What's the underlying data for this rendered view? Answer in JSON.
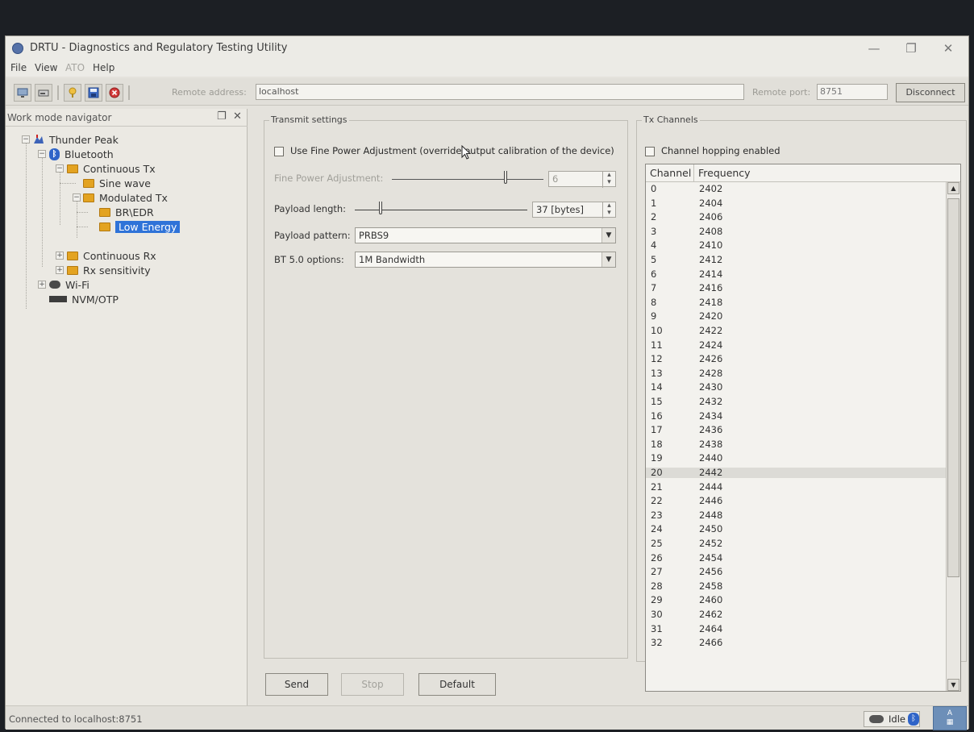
{
  "window": {
    "title": "DRTU - Diagnostics and Regulatory Testing Utility",
    "controls": {
      "minimize": "—",
      "restore": "❐",
      "close": "✕"
    }
  },
  "menu": [
    "File",
    "View",
    "ATO",
    "Help"
  ],
  "toolbar": {
    "remote_address_label": "Remote address:",
    "remote_address_value": "localhost",
    "remote_port_label": "Remote port:",
    "remote_port_value": "8751",
    "disconnect_label": "Disconnect",
    "icons": [
      "monitor-icon",
      "drive-icon",
      "pin-icon",
      "save-icon",
      "stop-icon"
    ]
  },
  "navigator": {
    "title": "Work mode navigator",
    "pin_glyph": "❐",
    "close_glyph": "✕",
    "items": [
      {
        "label": "Thunder Peak",
        "icon": "thunder-peak-icon",
        "expanded": true
      },
      {
        "label": "Bluetooth",
        "icon": "bluetooth-icon",
        "expanded": true
      },
      {
        "label": "Continuous Tx",
        "icon": "folder-icon",
        "expanded": true
      },
      {
        "label": "Sine wave",
        "icon": "folder-icon"
      },
      {
        "label": "Modulated Tx",
        "icon": "folder-icon",
        "expanded": true
      },
      {
        "label": "BR\\EDR",
        "icon": "folder-icon"
      },
      {
        "label": "Low Energy",
        "icon": "folder-icon",
        "selected": true
      },
      {
        "label": "Continuous Rx",
        "icon": "folder-icon",
        "expanded": false
      },
      {
        "label": "Rx sensitivity",
        "icon": "folder-icon",
        "expanded": false
      },
      {
        "label": "Wi-Fi",
        "icon": "wifi-icon",
        "expanded": false
      },
      {
        "label": "NVM/OTP",
        "icon": "nvm-icon"
      }
    ]
  },
  "transmit": {
    "group_title": "Transmit settings",
    "fine_power_checkbox_label": "Use Fine Power Adjustment (override output calibration of the device)",
    "fine_power_checked": false,
    "fine_power_label": "Fine Power Adjustment:",
    "fine_power_value": "6",
    "fine_power_slider_fraction": 0.75,
    "payload_length_label": "Payload length:",
    "payload_length_value": "37 [bytes]",
    "payload_length_slider_fraction": 0.15,
    "payload_pattern_label": "Payload pattern:",
    "payload_pattern_value": "PRBS9",
    "bt50_label": "BT 5.0 options:",
    "bt50_value": "1M Bandwidth"
  },
  "tx_channels": {
    "group_title": "Tx Channels",
    "hopping_label": "Channel hopping enabled",
    "hopping_checked": false,
    "columns": [
      "Channel",
      "Frequency"
    ],
    "highlighted_channel": "20",
    "rows": [
      [
        "0",
        "2402"
      ],
      [
        "1",
        "2404"
      ],
      [
        "2",
        "2406"
      ],
      [
        "3",
        "2408"
      ],
      [
        "4",
        "2410"
      ],
      [
        "5",
        "2412"
      ],
      [
        "6",
        "2414"
      ],
      [
        "7",
        "2416"
      ],
      [
        "8",
        "2418"
      ],
      [
        "9",
        "2420"
      ],
      [
        "10",
        "2422"
      ],
      [
        "11",
        "2424"
      ],
      [
        "12",
        "2426"
      ],
      [
        "13",
        "2428"
      ],
      [
        "14",
        "2430"
      ],
      [
        "15",
        "2432"
      ],
      [
        "16",
        "2434"
      ],
      [
        "17",
        "2436"
      ],
      [
        "18",
        "2438"
      ],
      [
        "19",
        "2440"
      ],
      [
        "20",
        "2442"
      ],
      [
        "21",
        "2444"
      ],
      [
        "22",
        "2446"
      ],
      [
        "23",
        "2448"
      ],
      [
        "24",
        "2450"
      ],
      [
        "25",
        "2452"
      ],
      [
        "26",
        "2454"
      ],
      [
        "27",
        "2456"
      ],
      [
        "28",
        "2458"
      ],
      [
        "29",
        "2460"
      ],
      [
        "30",
        "2462"
      ],
      [
        "31",
        "2464"
      ],
      [
        "32",
        "2466"
      ]
    ]
  },
  "buttons": {
    "send": "Send",
    "stop": "Stop",
    "default": "Default"
  },
  "status": {
    "text": "Connected to localhost:8751",
    "idle": "Idle"
  },
  "colors": {
    "selection": "#2f73d8",
    "folder": "#e3a321",
    "bluetooth": "#2f64c8"
  }
}
